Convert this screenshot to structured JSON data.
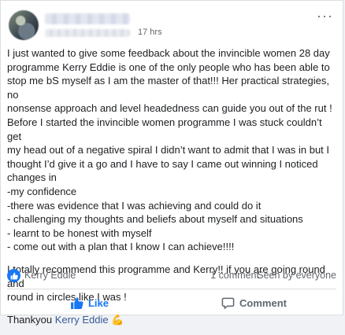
{
  "post": {
    "timestamp": "17 hrs",
    "more_label": "···",
    "body_lines": [
      "I just wanted to give some feedback about the invincible women 28 day",
      "programme Kerry Eddie is one of the only people who has been able to",
      "stop me bS myself as I am the master of that!!! Her practical strategies, no",
      "nonsense approach and level headedness can guide you out of the rut !",
      "Before I started the invincible women programme I was stuck couldn’t get",
      "my head out of a negative spiral I didn’t want to admit that I was in but I",
      "thought I’d give it a go and I have to say I came out winning I noticed",
      "changes in",
      "-my confidence",
      "-there was evidence that I was achieving and could do it",
      "- challenging my thoughts and beliefs about myself and situations",
      "- learnt to be honest with myself",
      "- come out with a plan that I know I can achieve!!!!"
    ],
    "recommend_lines": [
      "I totally recommend this programme and Kerry!! if you are going round and",
      "round in circles like I was !"
    ],
    "thanks_prefix": "Thankyou ",
    "thanks_mention": "Kerry Eddie",
    "thanks_emoji": "💪"
  },
  "stats": {
    "reactor": "Kerry Eddie",
    "comments": "1 comment",
    "seen": "Seen by everyone"
  },
  "actions": {
    "like": "Like",
    "comment": "Comment"
  },
  "colors": {
    "brand": "#1877f2",
    "link": "#385898",
    "muted": "#65676b"
  }
}
